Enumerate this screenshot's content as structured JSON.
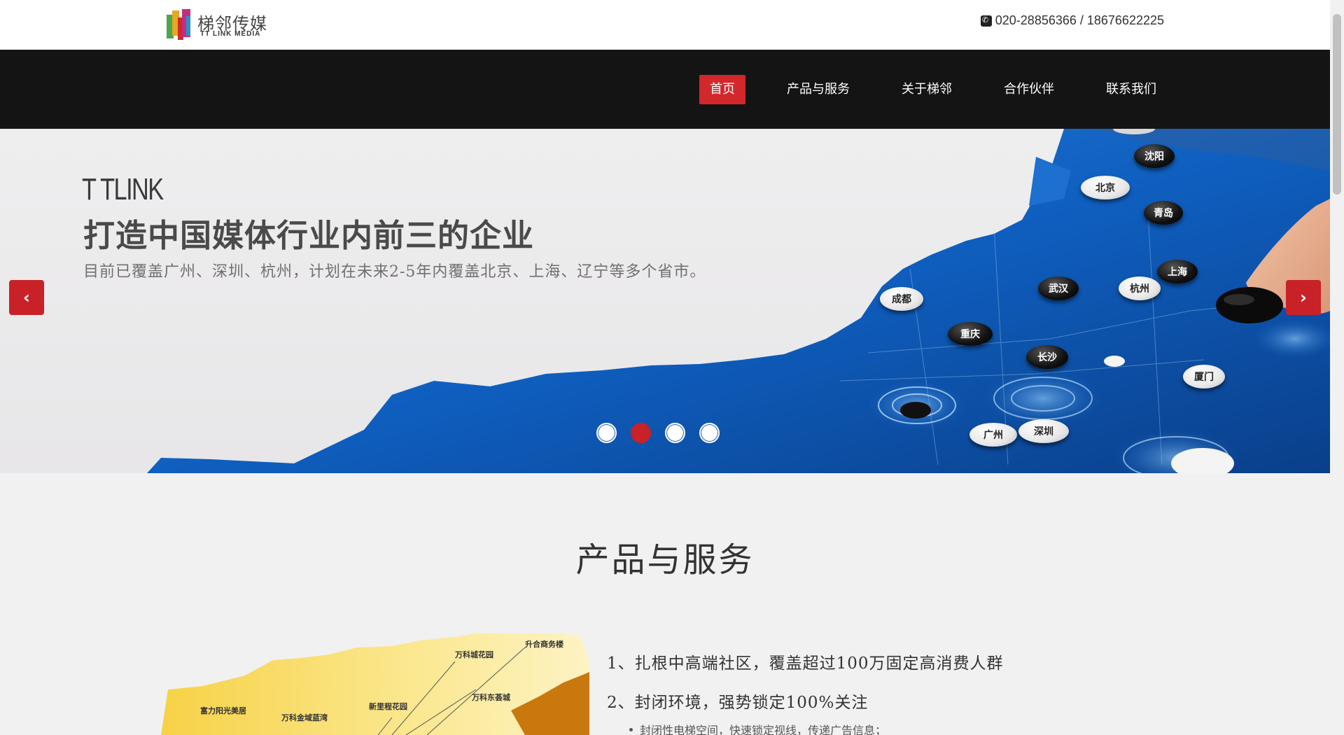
{
  "header": {
    "logo_cn": "梯邻传媒",
    "logo_en": "TT LINK MEDIA",
    "phone": "020-28856366 / 18676622225"
  },
  "nav": {
    "items": [
      {
        "label": "首页",
        "active": true
      },
      {
        "label": "产品与服务",
        "active": false
      },
      {
        "label": "关于梯邻",
        "active": false
      },
      {
        "label": "合作伙伴",
        "active": false
      },
      {
        "label": "联系我们",
        "active": false
      }
    ]
  },
  "hero": {
    "brand": "T TLINK",
    "title": "打造中国媒体行业内前三的企业",
    "subtitle": "目前已覆盖广州、深圳、杭州，计划在未来2-5年内覆盖北京、上海、辽宁等多个省市。",
    "prev_icon": "chevron-left-icon",
    "next_icon": "chevron-right-icon",
    "active_slide": 2,
    "slide_count": 4,
    "cities": [
      "沈阳",
      "北京",
      "青岛",
      "上海",
      "武汉",
      "杭州",
      "成都",
      "重庆",
      "长沙",
      "厦门",
      "广州",
      "深圳"
    ]
  },
  "products": {
    "title": "产品与服务",
    "map_labels": [
      "升合商务楼",
      "万科城花园",
      "新里程花园",
      "万科东荟城",
      "富力阳光美居",
      "万科金域蓝湾"
    ],
    "feature_1": "1、扎根中高端社区，覆盖超过100万固定高消费人群",
    "feature_2": "2、封闭环境，强势锁定100%关注",
    "feature_2_sub": "封闭性电梯空间，快速锁定视线，传递广告信息；"
  },
  "colors": {
    "accent": "#c82127",
    "nav_bg": "#141414",
    "sea": "#1a6fcf"
  }
}
